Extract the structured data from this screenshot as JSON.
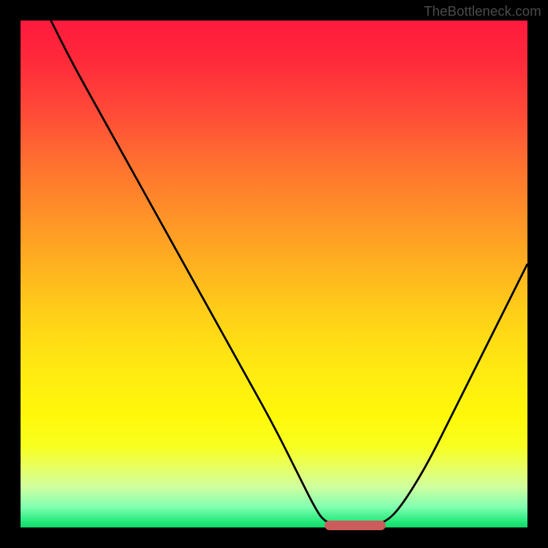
{
  "watermark": "TheBottleneck.com",
  "colors": {
    "background": "#000000",
    "curve_stroke": "#000000",
    "segment": "#cc5b5b",
    "gradient_top": "#ff1a3e",
    "gradient_bottom": "#10d868"
  },
  "chart_data": {
    "type": "line",
    "title": "",
    "xlabel": "",
    "ylabel": "",
    "xlim": [
      0,
      100
    ],
    "ylim": [
      0,
      100
    ],
    "note": "Bottleneck-style curve. X is an implicit hardware-balance axis (no ticks shown). Y is bottleneck percentage where 0 is at the bottom (optimal, green) and 100 is at the top (severe, red). The curve descends from top-left, reaches ~0 across a flat trough around x≈60-72, then rises toward top-right.",
    "x": [
      6,
      10,
      15,
      20,
      25,
      30,
      35,
      40,
      45,
      50,
      55,
      58,
      60,
      64,
      68,
      72,
      75,
      80,
      85,
      90,
      95,
      100
    ],
    "values": [
      100,
      92,
      83,
      74,
      65,
      56,
      47,
      38,
      29,
      20,
      10,
      4,
      1,
      0,
      0,
      1,
      4,
      12,
      22,
      32,
      42,
      52
    ],
    "optimal_range_x": [
      60,
      72
    ],
    "optimal_value": 0
  }
}
